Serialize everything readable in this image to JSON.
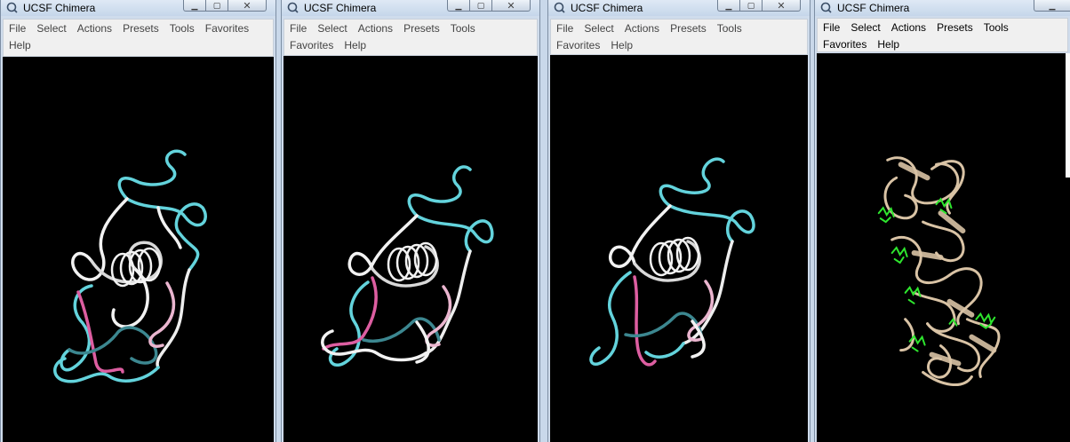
{
  "colors": {
    "cyan": "#63d3dc",
    "teal": "#3c8790",
    "white": "#f2f2f2",
    "pink": "#dd5ea1",
    "lightpink": "#eab5cf",
    "tan": "#d9c3a5",
    "green": "#2ee62e"
  },
  "windows": [
    {
      "title": "UCSF Chimera",
      "menu": [
        "File",
        "Select",
        "Actions",
        "Presets",
        "Tools",
        "Favorites",
        "Help"
      ],
      "controls": {
        "minimize": "minimize-icon",
        "maximize": "maximize-icon",
        "close": "close-icon"
      },
      "view": "protein-ribbon-colored"
    },
    {
      "title": "UCSF Chimera",
      "menu": [
        "File",
        "Select",
        "Actions",
        "Presets",
        "Tools",
        "Favorites",
        "Help"
      ],
      "controls": {
        "minimize": "minimize-icon",
        "maximize": "maximize-icon",
        "close": "close-icon"
      },
      "view": "protein-ribbon-colored"
    },
    {
      "title": "UCSF Chimera",
      "menu": [
        "File",
        "Select",
        "Actions",
        "Presets",
        "Tools",
        "Favorites",
        "Help"
      ],
      "controls": {
        "minimize": "minimize-icon",
        "maximize": "maximize-icon",
        "close": "close-icon"
      },
      "view": "protein-ribbon-colored"
    },
    {
      "title": "UCSF Chimera",
      "menu": [
        "File",
        "Select",
        "Actions",
        "Presets",
        "Tools",
        "Favorites",
        "Help"
      ],
      "controls": {
        "minimize": "minimize-icon",
        "maximize": "maximize-icon",
        "close": "close-icon"
      },
      "view": "protein-multimer-with-ligands"
    }
  ]
}
